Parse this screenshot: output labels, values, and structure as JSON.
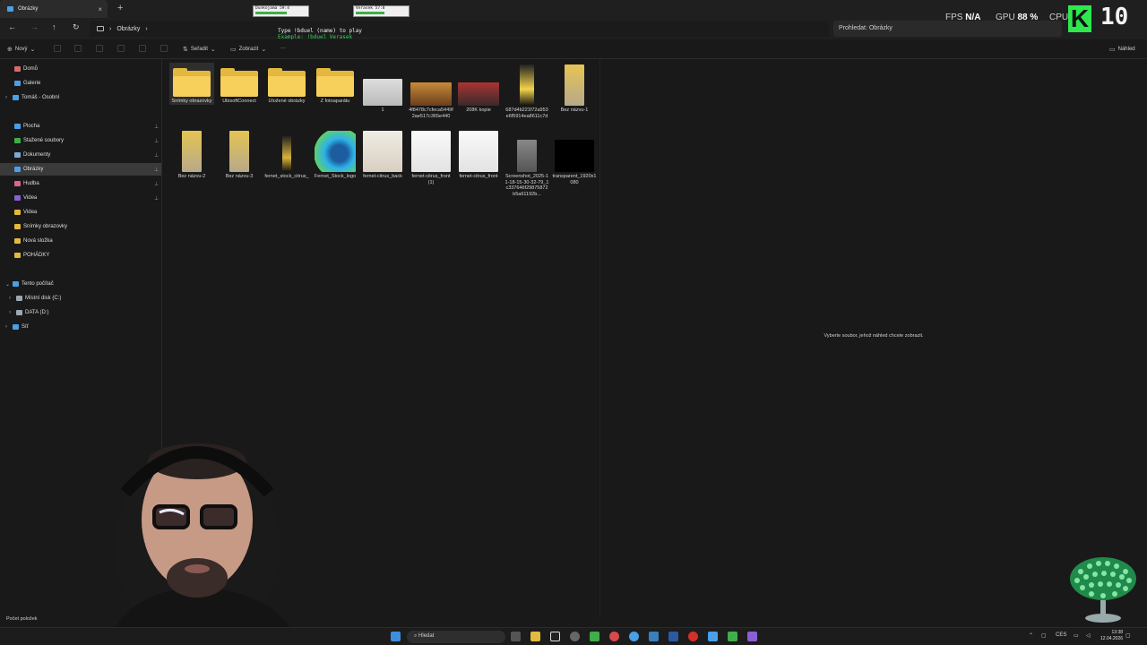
{
  "tab": {
    "title": "Obrázky",
    "close": "×",
    "new": "+"
  },
  "overlay_bars": [
    {
      "label": "Dunkojama   59:4",
      "fill": 0.6
    },
    {
      "label": "Verasek       57:8",
      "fill": 0.55
    }
  ],
  "address": {
    "path": "Obrázky",
    "sep": "›"
  },
  "search": {
    "placeholder": "Prohledat: Obrázky"
  },
  "cmd": {
    "line1": "Type !bduel (name) to play",
    "line2": "Example: !bduel Verasek"
  },
  "hud": {
    "fps_label": "FPS",
    "fps_value": "N/A",
    "gpu_label": "GPU",
    "gpu_value": "88 %",
    "cpu_label": "CPU",
    "logo_letter": "K",
    "level": "10"
  },
  "toolbar": {
    "new": "Nový",
    "sort": "Seřadit",
    "view": "Zobrazit",
    "more": "···",
    "preview": "Náhled"
  },
  "sidebar": {
    "items": [
      {
        "label": "Domů",
        "color": "#d86a6a"
      },
      {
        "label": "Galerie",
        "color": "#4aa0e8"
      },
      {
        "label": "Tomáš - Osobní",
        "color": "#4aa0e8"
      },
      {
        "label": "Plocha",
        "color": "#4aa0e8"
      },
      {
        "label": "Stažené soubory",
        "color": "#3fae49"
      },
      {
        "label": "Dokumenty",
        "color": "#7fa8d8"
      },
      {
        "label": "Obrázky",
        "color": "#4aa0e8"
      },
      {
        "label": "Hudba",
        "color": "#e0648a"
      },
      {
        "label": "Videa",
        "color": "#8a5fd6"
      },
      {
        "label": "Videa",
        "color": "#e3b83e"
      },
      {
        "label": "Snímky obrazovky",
        "color": "#e3b83e"
      },
      {
        "label": "Nová složka",
        "color": "#e3b83e"
      },
      {
        "label": "POHÁDKY",
        "color": "#e3b83e"
      },
      {
        "label": "Tento počítač",
        "color": "#4aa0e8"
      },
      {
        "label": "Místní disk (C:)",
        "color": "#9aa7b4"
      },
      {
        "label": "DATA (D:)",
        "color": "#9aa7b4"
      },
      {
        "label": "Síť",
        "color": "#4aa0e8"
      }
    ]
  },
  "files": [
    {
      "name": "Snímky obrazovky",
      "kind": "folder"
    },
    {
      "name": "UbisoftConnect",
      "kind": "folder"
    },
    {
      "name": "Uložené obrázky",
      "kind": "folder"
    },
    {
      "name": "Z fotoaparátu",
      "kind": "folder"
    },
    {
      "name": "1",
      "kind": "image"
    },
    {
      "name": "4f8478c7cfeca5449f2ae517c365e440",
      "kind": "image"
    },
    {
      "name": "208K kopie",
      "kind": "image"
    },
    {
      "name": "687d4b221f72a953e6f5914ea8611c7d",
      "kind": "image"
    },
    {
      "name": "Bez názvu-1",
      "kind": "image"
    },
    {
      "name": "Bez názvu-2",
      "kind": "image"
    },
    {
      "name": "Bez názvu-3",
      "kind": "image"
    },
    {
      "name": "fernet_stock_citrus_",
      "kind": "image"
    },
    {
      "name": "Fernet_Stock_logo",
      "kind": "image"
    },
    {
      "name": "fernet-citrus_back",
      "kind": "image"
    },
    {
      "name": "fernet-citrus_front (1)",
      "kind": "image"
    },
    {
      "name": "fernet-citrus_front",
      "kind": "image"
    },
    {
      "name": "Screenshot_2025-11-18-15-30-32-79_1c337646f29875872b5a61192b...",
      "kind": "image"
    },
    {
      "name": "transparent_1920x1080",
      "kind": "image"
    }
  ],
  "preview_pane": {
    "message": "Vyberte soubor, jehož náhled chcete zobrazit."
  },
  "status": {
    "count": "Počet položek"
  },
  "taskbar": {
    "search": "Hledat",
    "lang": "CES",
    "time": "13:38",
    "date": "12.04.2026"
  },
  "colors": {
    "folder": "#f7cf5b",
    "accent": "#4aa0e8",
    "hud_green": "#2ee84e"
  }
}
